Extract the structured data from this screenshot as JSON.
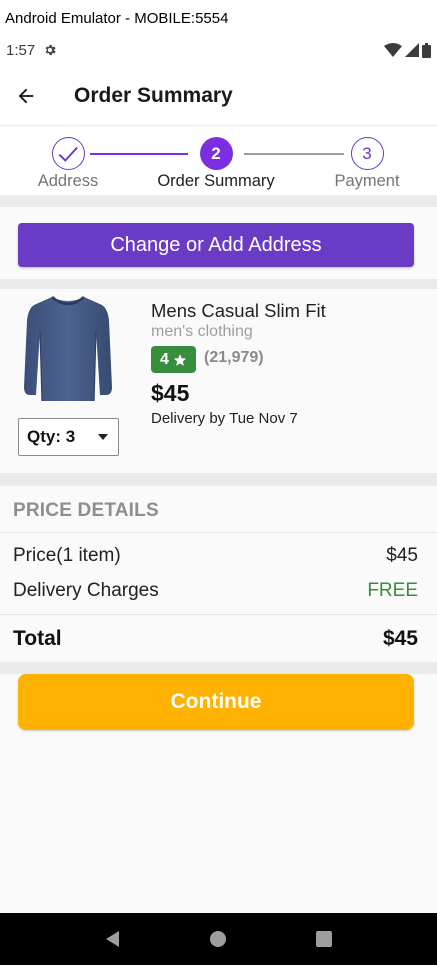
{
  "emulator": {
    "title": "Android Emulator - MOBILE:5554"
  },
  "status_bar": {
    "time": "1:57",
    "icons": [
      "gear-icon",
      "wifi-icon",
      "signal-icon",
      "battery-icon"
    ]
  },
  "app_bar": {
    "back_icon": "arrow-left-icon",
    "title": "Order Summary"
  },
  "stepper": {
    "steps": [
      {
        "label": "Address",
        "state": "done",
        "icon": "check-icon"
      },
      {
        "label": "Order Summary",
        "state": "active",
        "number": "2"
      },
      {
        "label": "Payment",
        "state": "todo",
        "number": "3"
      }
    ],
    "accent": "#7b2fe0"
  },
  "address": {
    "button_label": "Change or Add Address",
    "color": "#6a3bc4"
  },
  "product": {
    "image_icon": "shirt-image",
    "title": "Mens Casual Slim Fit",
    "category": "men's clothing",
    "rating": "4",
    "rating_icon": "star-icon",
    "rating_count": "(21,979)",
    "price": "$45",
    "delivery": "Delivery by Tue Nov 7",
    "qty_label": "Qty: 3",
    "qty_icon": "caret-down-icon"
  },
  "price_details": {
    "header": "PRICE DETAILS",
    "rows": [
      {
        "label": "Price(1 item)",
        "value": "$45"
      },
      {
        "label": "Delivery Charges",
        "value": "FREE"
      }
    ],
    "total_label": "Total",
    "total_value": "$45",
    "free_color": "#388e3c"
  },
  "continue": {
    "label": "Continue",
    "color": "#ffb300"
  },
  "nav_bar": {
    "icons": [
      "back-triangle-icon",
      "home-circle-icon",
      "recents-square-icon"
    ]
  }
}
